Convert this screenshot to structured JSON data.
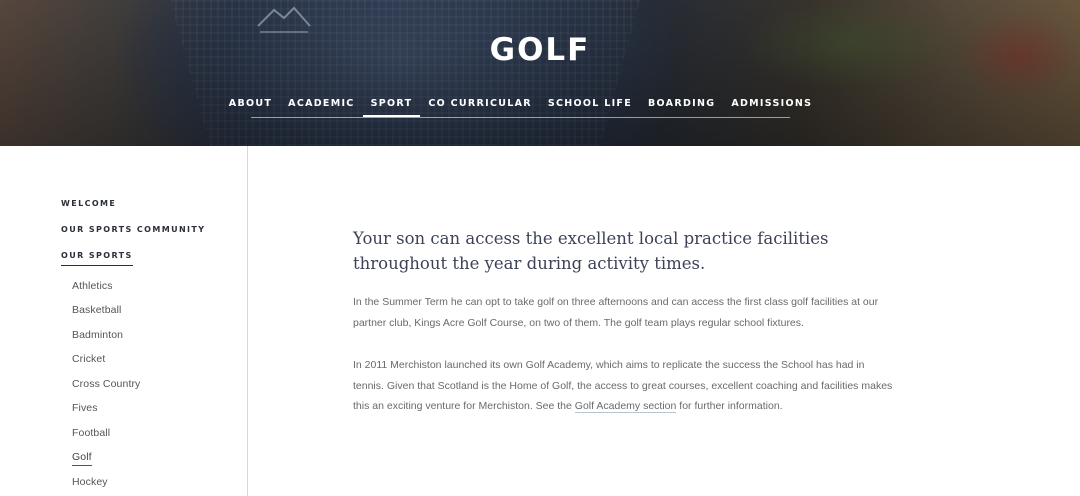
{
  "header": {
    "title": "GOLF",
    "nav": [
      {
        "label": "ABOUT",
        "active": false
      },
      {
        "label": "ACADEMIC",
        "active": false
      },
      {
        "label": "SPORT",
        "active": true
      },
      {
        "label": "CO CURRICULAR",
        "active": false
      },
      {
        "label": "SCHOOL LIFE",
        "active": false
      },
      {
        "label": "BOARDING",
        "active": false
      },
      {
        "label": "ADMISSIONS",
        "active": false
      }
    ]
  },
  "sidebar": {
    "headings": [
      {
        "label": "WELCOME",
        "active": false
      },
      {
        "label": "OUR SPORTS COMMUNITY",
        "active": false
      },
      {
        "label": "OUR SPORTS",
        "active": true
      }
    ],
    "items": [
      {
        "label": "Athletics",
        "active": false
      },
      {
        "label": "Basketball",
        "active": false
      },
      {
        "label": "Badminton",
        "active": false
      },
      {
        "label": "Cricket",
        "active": false
      },
      {
        "label": "Cross Country",
        "active": false
      },
      {
        "label": "Fives",
        "active": false
      },
      {
        "label": "Football",
        "active": false
      },
      {
        "label": "Golf",
        "active": true
      },
      {
        "label": "Hockey",
        "active": false
      }
    ]
  },
  "content": {
    "lead": "Your son can access the excellent local practice facilities throughout the year during activity times.",
    "paragraph1": "In the Summer Term he can opt to take golf on three afternoons and can access the first class golf facilities at our partner club, Kings Acre Golf Course, on two of them. The golf team plays regular school fixtures.",
    "paragraph2_before_link": "In 2011 Merchiston launched its own Golf Academy, which aims to replicate the success the School has had in tennis. Given that Scotland is the Home of Golf, the access to great courses, excellent coaching and facilities makes this an exciting venture for Merchiston. See the ",
    "paragraph2_link": "Golf Academy section",
    "paragraph2_after_link": " for further information."
  },
  "colors": {
    "heading_text": "#3c4356",
    "body_text": "#6a6a6a",
    "nav_text": "#ffffff",
    "sidebar_heading": "#2a2f3a"
  }
}
